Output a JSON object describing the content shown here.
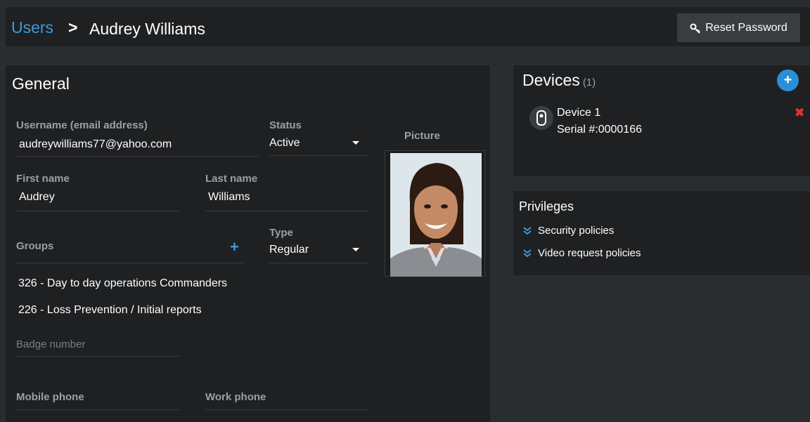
{
  "header": {
    "breadcrumb_root": "Users",
    "breadcrumb_separator": ">",
    "title": "Audrey Williams",
    "reset_password_label": "Reset Password"
  },
  "general": {
    "heading": "General",
    "username": {
      "label": "Username (email address)",
      "value": "audreywilliams77@yahoo.com"
    },
    "status": {
      "label": "Status",
      "value": "Active"
    },
    "first_name": {
      "label": "First name",
      "value": "Audrey"
    },
    "last_name": {
      "label": "Last name",
      "value": "Williams"
    },
    "groups": {
      "label": "Groups",
      "items": [
        "326 - Day to day operations Commanders",
        "226 - Loss Prevention / Initial reports"
      ]
    },
    "type": {
      "label": "Type",
      "value": "Regular"
    },
    "badge_number": {
      "placeholder": "Badge number"
    },
    "mobile_phone": {
      "label": "Mobile phone"
    },
    "work_phone": {
      "label": "Work phone"
    },
    "picture_label": "Picture"
  },
  "devices": {
    "heading": "Devices",
    "count": "(1)",
    "items": [
      {
        "name": "Device 1",
        "serial": "Serial #:0000166"
      }
    ]
  },
  "privileges": {
    "heading": "Privileges",
    "items": [
      "Security policies",
      "Video request policies"
    ]
  },
  "colors": {
    "accent": "#3a9bd9",
    "background": "#2a2d30",
    "panel": "#1e2022",
    "danger": "#e03030"
  }
}
